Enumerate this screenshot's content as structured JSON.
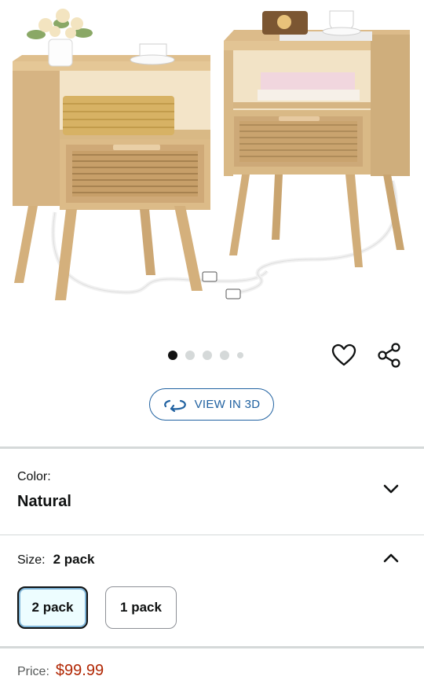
{
  "gallery": {
    "image_alt": "Two rattan nightstands with charging cords",
    "dots_count": 5,
    "active_dot": 0
  },
  "actions": {
    "favorite_icon": "heart-icon",
    "share_icon": "share-icon"
  },
  "view3d": {
    "label": "VIEW IN 3D",
    "icon": "rotate-3d-icon"
  },
  "color": {
    "label": "Color:",
    "value": "Natural",
    "expanded": false
  },
  "size": {
    "label": "Size:",
    "value": "2 pack",
    "expanded": true,
    "options": [
      {
        "label": "2 pack",
        "selected": true
      },
      {
        "label": "1 pack",
        "selected": false
      }
    ]
  },
  "price": {
    "label": "Price:",
    "value": "$99.99"
  },
  "colors": {
    "accent": "#2162a1",
    "price": "#b12704",
    "divider": "#d5d9d9"
  }
}
